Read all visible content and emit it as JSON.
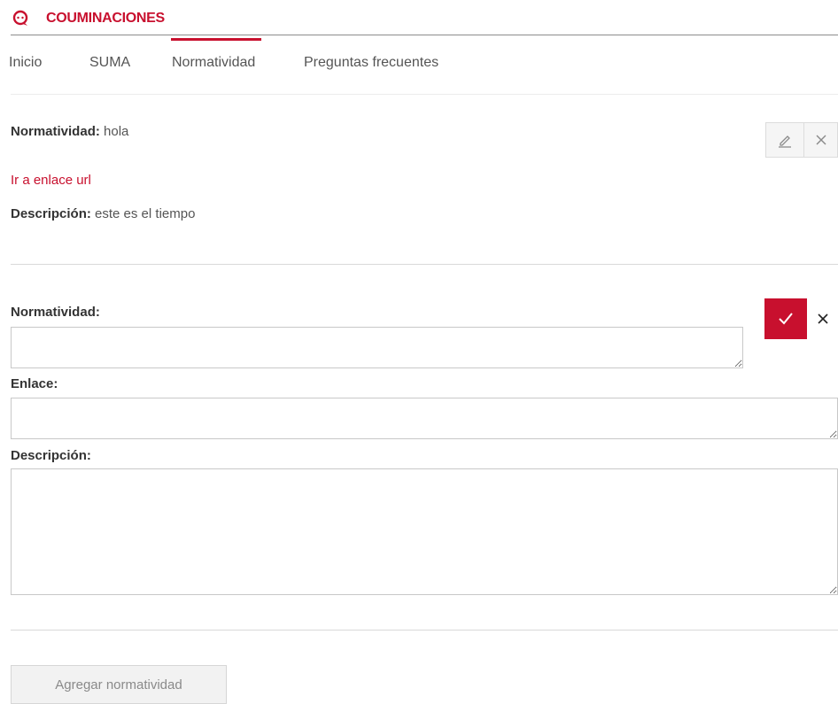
{
  "app": {
    "title": "COUMINACIONES",
    "brand_color": "#c8102e",
    "logo_icon": "chat-bubbles-icon"
  },
  "tabs": [
    {
      "label": "Inicio",
      "active": false
    },
    {
      "label": "SUMA",
      "active": false
    },
    {
      "label": "Normatividad",
      "active": true
    },
    {
      "label": "Preguntas frecuentes",
      "active": false
    }
  ],
  "entry": {
    "normatividad_label": "Normatividad:",
    "normatividad_value": "hola",
    "link_text": "Ir a enlace url",
    "descripcion_label": "Descripción:",
    "descripcion_value": "este es el tiempo",
    "edit_icon": "pencil-icon",
    "delete_icon": "close-icon"
  },
  "form": {
    "normatividad_label": "Normatividad:",
    "normatividad_value": "",
    "enlace_label": "Enlace:",
    "enlace_value": "",
    "descripcion_label": "Descripción:",
    "descripcion_value": "",
    "confirm_icon": "checkmark-icon",
    "cancel_icon": "close-icon"
  },
  "actions": {
    "add_button_label": "Agregar normatividad"
  }
}
